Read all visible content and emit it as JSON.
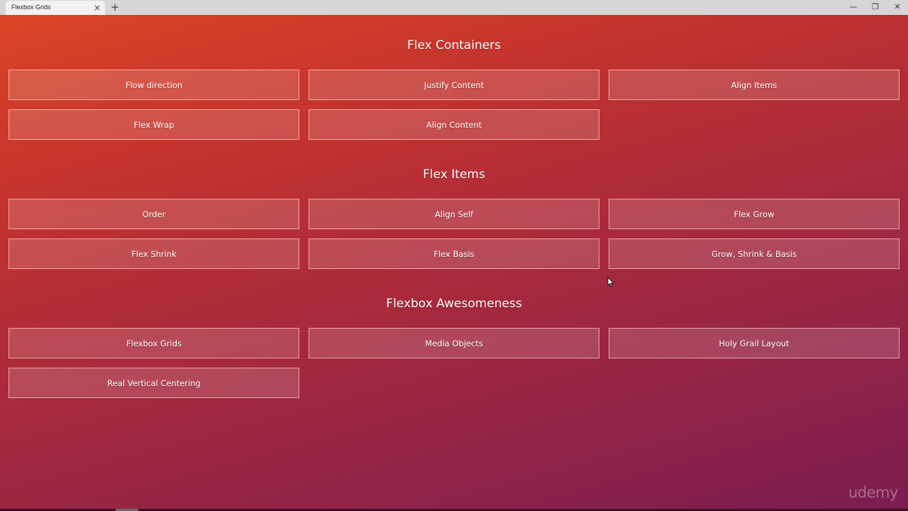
{
  "browser": {
    "tab_title": "Flexbox Grids",
    "tab_close_icon": "×",
    "new_tab_icon": "+",
    "minimize_icon": "—",
    "maximize_icon": "❐",
    "close_icon": "✕"
  },
  "sections": [
    {
      "title": "Flex Containers",
      "buttons": [
        "Flow direction",
        "Justify Content",
        "Align Items",
        "Flex Wrap",
        "Align Content"
      ]
    },
    {
      "title": "Flex Items",
      "buttons": [
        "Order",
        "Align Self",
        "Flex Grow",
        "Flex Shrink",
        "Flex Basis",
        "Grow, Shrink & Basis"
      ]
    },
    {
      "title": "Flexbox Awesomeness",
      "buttons": [
        "Flexbox Grids",
        "Media Objects",
        "Holy Grail Layout",
        "Real Vertical Centering"
      ]
    }
  ],
  "watermark": "udemy",
  "colors": {
    "gradient_start": "#dc4526",
    "gradient_end": "#7a1d50"
  }
}
